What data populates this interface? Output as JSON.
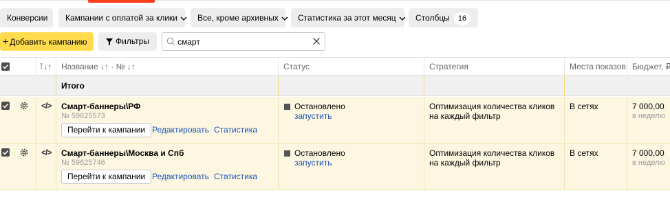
{
  "toolbar": {
    "chips": [
      {
        "label": "Конверсии"
      },
      {
        "label": "Кампании с оплатой за клики"
      },
      {
        "label": "Все, кроме архивных"
      },
      {
        "label": "Статистика за этот месяц"
      }
    ],
    "columns_label": "Столбцы",
    "columns_count": "16",
    "add_campaign": "Добавить кампанию",
    "filters": "Фильтры",
    "search_value": "смарт"
  },
  "table": {
    "headers": {
      "name": "Название",
      "status": "Статус",
      "strategy": "Стратегия",
      "places": "Места показов",
      "budget": "Бюджет, ₽"
    },
    "total_label": "Итого",
    "rows": [
      {
        "name": "Смарт-баннеры\\РФ",
        "number": "№ 59625573",
        "go_button": "Перейти к кампании",
        "edit_link": "Редактировать",
        "stats_link": "Статистика",
        "status": "Остановлено",
        "status_action": "запустить",
        "strategy": "Оптимизация количества кликов на каждый фильтр",
        "places": "В сетях",
        "budget": "7 000,00",
        "budget_period": "в неделю"
      },
      {
        "name": "Смарт-баннеры\\Москва и Спб",
        "number": "№ 59625746",
        "go_button": "Перейти к кампании",
        "edit_link": "Редактировать",
        "stats_link": "Статистика",
        "status": "Остановлено",
        "status_action": "запустить",
        "strategy": "Оптимизация количества кликов на каждый фильтр",
        "places": "В сетях",
        "budget": "7 000,00",
        "budget_period": "в неделю"
      }
    ]
  },
  "colors": {
    "accent_yellow": "#ffdb4d",
    "tab_red": "#fc3f1d",
    "link_blue": "#1a52b5",
    "row_highlight": "#fdf7e1"
  }
}
